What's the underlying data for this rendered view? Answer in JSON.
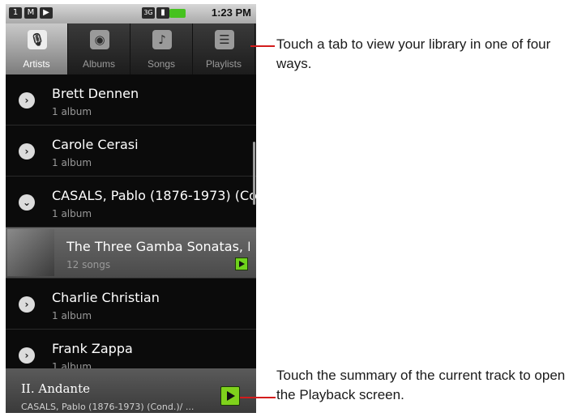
{
  "status_bar": {
    "time": "1:23 PM",
    "icons": [
      "sim-icon",
      "gmail-icon",
      "play-icon",
      "3g-icon",
      "signal-icon",
      "battery-icon"
    ]
  },
  "tabs": [
    {
      "label": "Artists",
      "icon": "microphone-icon",
      "active": true
    },
    {
      "label": "Albums",
      "icon": "disc-icon",
      "active": false
    },
    {
      "label": "Songs",
      "icon": "music-note-icon",
      "active": false
    },
    {
      "label": "Playlists",
      "icon": "list-icon",
      "active": false
    }
  ],
  "list": [
    {
      "title": "Brett Dennen",
      "subtitle": "1 album",
      "state": "collapsed"
    },
    {
      "title": "Carole Cerasi",
      "subtitle": "1 album",
      "state": "collapsed"
    },
    {
      "title": "CASALS, Pablo (1876-1973) (Co",
      "subtitle": "1 album",
      "state": "expanded"
    },
    {
      "title": "The Three Gamba Sonatas, E",
      "subtitle": "12 songs",
      "state": "album"
    },
    {
      "title": "Charlie Christian",
      "subtitle": "1 album",
      "state": "collapsed"
    },
    {
      "title": "Frank Zappa",
      "subtitle": "1 album",
      "state": "collapsed"
    }
  ],
  "now_playing": {
    "title": "II. Andante",
    "subtitle": "CASALS, Pablo (1876-1973) (Cond.)/ ..."
  },
  "callouts": {
    "tabs": "Touch a tab to view your library in one of four ways.",
    "now_playing": "Touch the summary of the current track to open the Playback screen."
  },
  "colors": {
    "accent_red": "#d31c1c",
    "play_green": "#7fd21c"
  }
}
